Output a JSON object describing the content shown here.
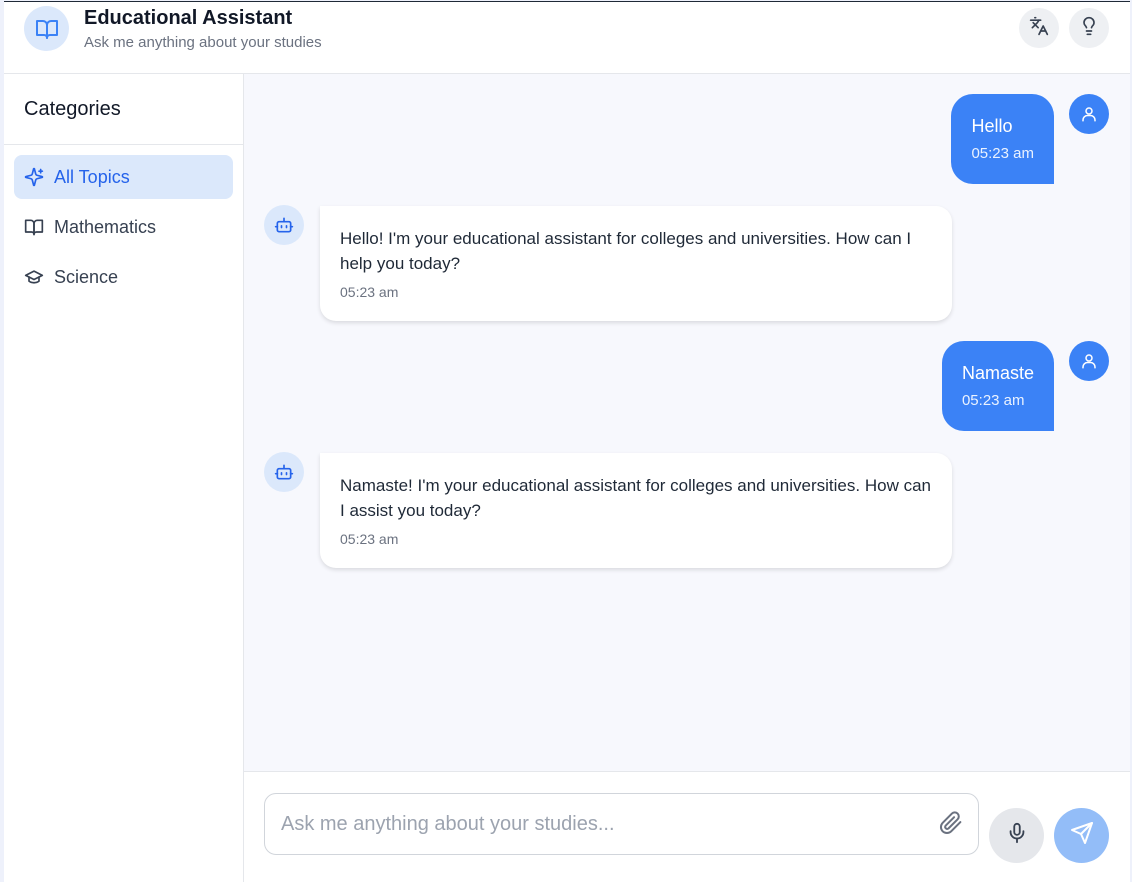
{
  "header": {
    "title": "Educational Assistant",
    "subtitle": "Ask me anything about your studies",
    "logo_icon": "open-book-icon",
    "buttons": [
      {
        "icon": "translate-icon"
      },
      {
        "icon": "lightbulb-icon"
      }
    ]
  },
  "sidebar": {
    "title": "Categories",
    "items": [
      {
        "label": "All Topics",
        "icon": "sparkles-icon",
        "active": true
      },
      {
        "label": "Mathematics",
        "icon": "open-book-icon",
        "active": false
      },
      {
        "label": "Science",
        "icon": "graduation-cap-icon",
        "active": false
      }
    ]
  },
  "messages": [
    {
      "role": "user",
      "text": "Hello",
      "time": "05:23 am"
    },
    {
      "role": "bot",
      "text": "Hello! I'm your educational assistant for colleges and universities. How can I help you today?",
      "time": "05:23 am"
    },
    {
      "role": "user",
      "text": "Namaste",
      "time": "05:23 am"
    },
    {
      "role": "bot",
      "text": "Namaste! I'm your educational assistant for colleges and universities. How can I assist you today?",
      "time": "05:23 am"
    }
  ],
  "composer": {
    "placeholder": "Ask me anything about your studies...",
    "value": "",
    "attach_icon": "paperclip-icon",
    "mic_icon": "microphone-icon",
    "send_icon": "send-icon"
  },
  "colors": {
    "accent": "#3b82f6",
    "accent_light": "#dbe8fb",
    "send_disabled": "#93bdf8"
  }
}
